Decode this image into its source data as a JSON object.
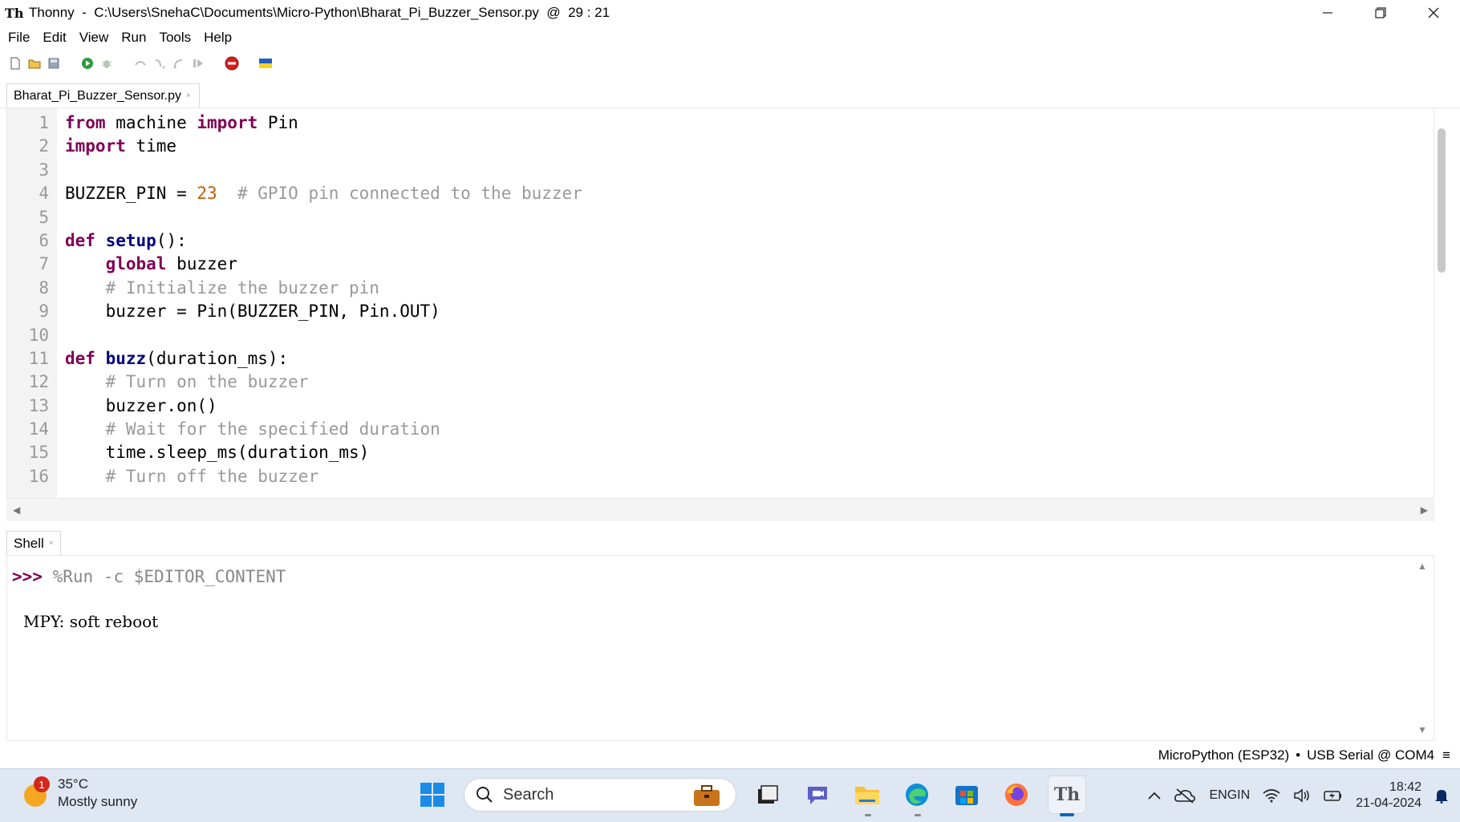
{
  "window": {
    "app_name": "Thonny",
    "path": "C:\\Users\\SnehaC\\Documents\\Micro-Python\\Bharat_Pi_Buzzer_Sensor.py",
    "cursor_pos": "29 : 21"
  },
  "menu": [
    "File",
    "Edit",
    "View",
    "Run",
    "Tools",
    "Help"
  ],
  "editor": {
    "tab_label": "Bharat_Pi_Buzzer_Sensor.py",
    "line_numbers": [
      "1",
      "2",
      "3",
      "4",
      "5",
      "6",
      "7",
      "8",
      "9",
      "10",
      "11",
      "12",
      "13",
      "14",
      "15",
      "16"
    ]
  },
  "shell": {
    "tab_label": "Shell",
    "prompt": ">>>",
    "command": " %Run -c $EDITOR_CONTENT",
    "output": "MPY: soft reboot"
  },
  "status": {
    "interpreter": "MicroPython (ESP32)",
    "port": "USB Serial @ COM4"
  },
  "taskbar": {
    "weather_temp": "35°C",
    "weather_desc": "Mostly sunny",
    "weather_badge": "1",
    "search_label": "Search",
    "lang_top": "ENG",
    "lang_bottom": "IN",
    "time": "18:42",
    "date": "21-04-2024"
  },
  "colors": {
    "keyword": "#7f0055",
    "function_name": "#000080",
    "number": "#c35d00",
    "comment": "#999999",
    "taskbar_bg": "#dfe7f3"
  }
}
